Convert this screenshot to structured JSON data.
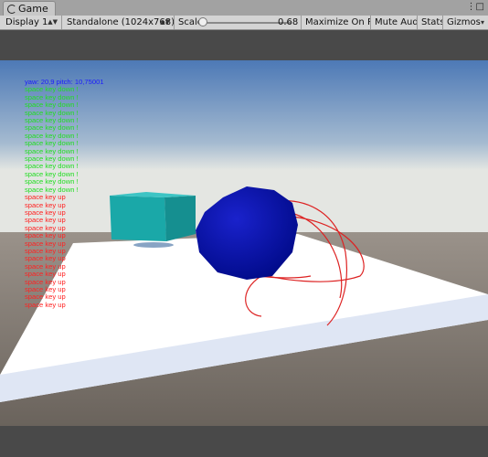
{
  "window": {
    "tab_title": "Game"
  },
  "toolbar": {
    "display": "Display 1",
    "resolution": "Standalone (1024x768)",
    "scale_label": "Scale",
    "scale_value": "0.68",
    "maximize_on_play": "Maximize On Play",
    "mute_audio": "Mute Audio",
    "stats": "Stats",
    "gizmos": "Gizmos"
  },
  "overlay": {
    "yaw_pitch": "yaw: 20,9 pitch: 10,75001",
    "log_lines": [
      {
        "text": "space key down !",
        "type": "down"
      },
      {
        "text": "space key down !",
        "type": "down"
      },
      {
        "text": "space key down !",
        "type": "down"
      },
      {
        "text": "space key down !",
        "type": "down"
      },
      {
        "text": "space key down !",
        "type": "down"
      },
      {
        "text": "space key down !",
        "type": "down"
      },
      {
        "text": "space key down !",
        "type": "down"
      },
      {
        "text": "space key down !",
        "type": "down"
      },
      {
        "text": "space key down !",
        "type": "down"
      },
      {
        "text": "space key down !",
        "type": "down"
      },
      {
        "text": "space key down !",
        "type": "down"
      },
      {
        "text": "space key down !",
        "type": "down"
      },
      {
        "text": "space key down !",
        "type": "down"
      },
      {
        "text": "space key down !",
        "type": "down"
      },
      {
        "text": "space key up",
        "type": "up"
      },
      {
        "text": "space key up",
        "type": "up"
      },
      {
        "text": "space key up",
        "type": "up"
      },
      {
        "text": "space key up",
        "type": "up"
      },
      {
        "text": "space key up",
        "type": "up"
      },
      {
        "text": "space key up",
        "type": "up"
      },
      {
        "text": "space key up",
        "type": "up"
      },
      {
        "text": "space key up",
        "type": "up"
      },
      {
        "text": "space key up",
        "type": "up"
      },
      {
        "text": "space key up",
        "type": "up"
      },
      {
        "text": "space key up",
        "type": "up"
      },
      {
        "text": "space key up",
        "type": "up"
      },
      {
        "text": "space key up",
        "type": "up"
      },
      {
        "text": "space key up",
        "type": "up"
      },
      {
        "text": "space key up",
        "type": "up"
      }
    ]
  },
  "colors": {
    "cube": "#1aa8a8",
    "sphere": "#0a12b0",
    "gizmo": "#dd2222",
    "ground": "#ffffff"
  },
  "icons": {
    "tab": "unity-logo-icon",
    "window_menu": "window-menu-icon",
    "dropdown": "dropdown-arrow-icon"
  }
}
